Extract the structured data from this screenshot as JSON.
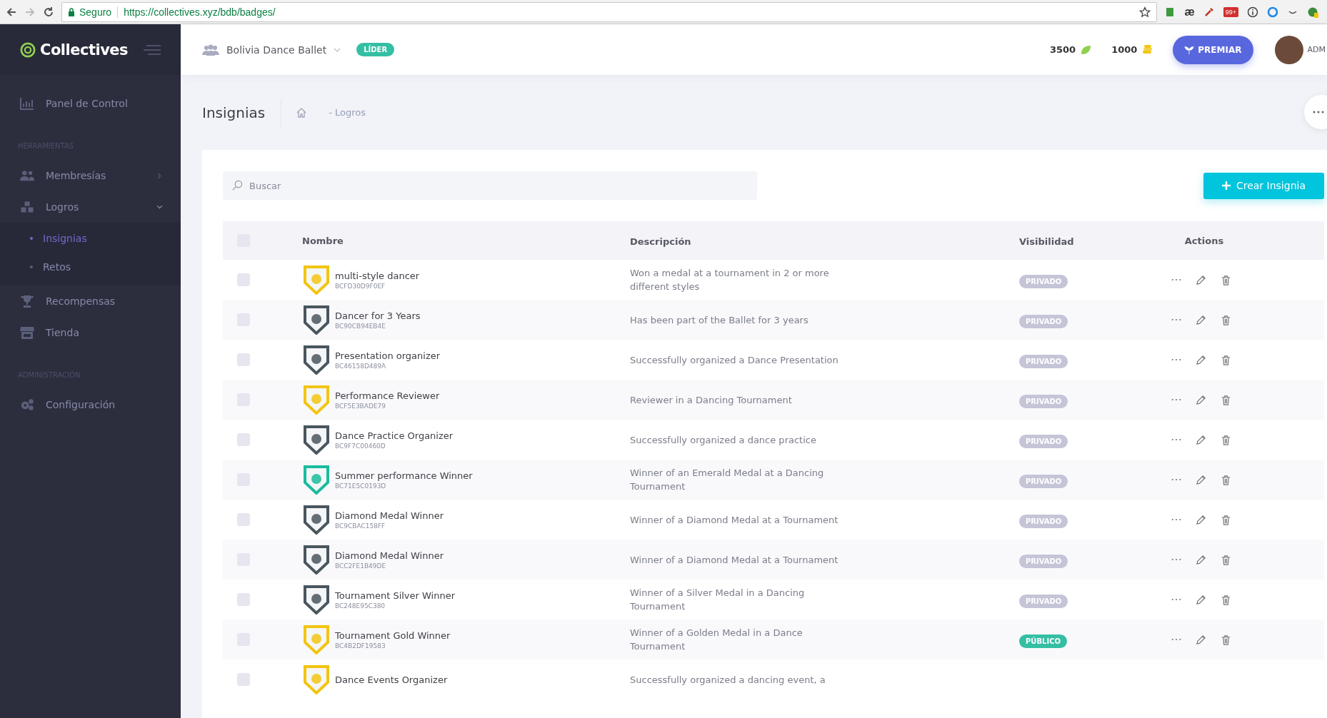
{
  "browser": {
    "secure_label": "Seguro",
    "url": "https://collectives.xyz/bdb/badges/",
    "extension_text": "æ",
    "extension_badge": "99+"
  },
  "sidebar": {
    "logo": "Collectives",
    "items": [
      {
        "kind": "chart",
        "label": "Panel de Control",
        "selected": false
      },
      {
        "kind": "heading",
        "label": "HERRAMIENTAS"
      },
      {
        "kind": "people",
        "label": "Membresías",
        "selected": false,
        "expanded": false
      },
      {
        "kind": "cubes",
        "label": "Logros",
        "selected": false,
        "expanded": true,
        "children": [
          {
            "label": "Insignias",
            "selected": true
          },
          {
            "label": "Retos",
            "selected": false
          }
        ]
      },
      {
        "kind": "trophy",
        "label": "Recompensas",
        "selected": false
      },
      {
        "kind": "store",
        "label": "Tienda",
        "selected": false
      },
      {
        "kind": "heading",
        "label": "ADMINISTRACIÓN"
      },
      {
        "kind": "gears",
        "label": "Configuración",
        "selected": false
      }
    ]
  },
  "header": {
    "group": "Bolivia Dance Ballet",
    "role": "LÍDER",
    "points": "3500",
    "coins": "1000",
    "award_button": "PREMIAR",
    "user": "ADM"
  },
  "page": {
    "title": "Insignias",
    "breadcrumb": "- Logros"
  },
  "search": {
    "placeholder": "Buscar"
  },
  "create_button": "Crear Insignia",
  "table": {
    "select_all_checked": false,
    "columns": [
      "Nombre",
      "Descripción",
      "Visibilidad",
      "Actions"
    ],
    "rows": [
      {
        "checked": false,
        "color": "#f2c511",
        "name": "multi-style dancer",
        "code": "BCFD30D9F0EF",
        "description": "Won a medal at a tournament in 2 or more different styles",
        "visibility": {
          "kind": "private",
          "label": "PRIVADO"
        }
      },
      {
        "checked": false,
        "color": "#4a565e",
        "name": "Dancer for 3 Years",
        "code": "BC90CB94EB4E",
        "description": "Has been part of the Ballet for 3 years",
        "visibility": {
          "kind": "private",
          "label": "PRIVADO"
        }
      },
      {
        "checked": false,
        "color": "#4a565e",
        "name": "Presentation organizer",
        "code": "BC46158D489A",
        "description": "Successfully organized a Dance Presentation",
        "visibility": {
          "kind": "private",
          "label": "PRIVADO"
        }
      },
      {
        "checked": false,
        "color": "#f2c511",
        "name": "Performance Reviewer",
        "code": "BCF5E3BADE79",
        "description": "Reviewer in a Dancing Tournament",
        "visibility": {
          "kind": "private",
          "label": "PRIVADO"
        }
      },
      {
        "checked": false,
        "color": "#4a565e",
        "name": "Dance Practice Organizer",
        "code": "BC9F7C00460D",
        "description": "Successfully organized a dance practice",
        "visibility": {
          "kind": "private",
          "label": "PRIVADO"
        }
      },
      {
        "checked": false,
        "color": "#1abc9c",
        "name": "Summer performance Winner",
        "code": "BC71E5C0193D",
        "description": "Winner of an Emerald Medal at a Dancing Tournament",
        "visibility": {
          "kind": "private",
          "label": "PRIVADO"
        }
      },
      {
        "checked": false,
        "color": "#4a565e",
        "name": "Diamond Medal Winner",
        "code": "BC9CBAC158FF",
        "description": "Winner of a Diamond Medal at a Tournament",
        "visibility": {
          "kind": "private",
          "label": "PRIVADO"
        }
      },
      {
        "checked": false,
        "color": "#4a565e",
        "name": "Diamond Medal Winner",
        "code": "BCC2FE1B49DE",
        "description": "Winner of a Diamond Medal at a Tournament",
        "visibility": {
          "kind": "private",
          "label": "PRIVADO"
        }
      },
      {
        "checked": false,
        "color": "#4a565e",
        "name": "Tournament Silver Winner",
        "code": "BC248E95C380",
        "description": "Winner of a Silver Medal in a Dancing Tournament",
        "visibility": {
          "kind": "private",
          "label": "PRIVADO"
        }
      },
      {
        "checked": false,
        "color": "#f2c511",
        "name": "Tournament Gold Winner",
        "code": "BC4B2DF19583",
        "description": "Winner of a Golden Medal in a Dance Tournament",
        "visibility": {
          "kind": "public",
          "label": "PÚBLICO"
        }
      },
      {
        "checked": false,
        "color": "#f2c511",
        "name": "Dance Events Organizer",
        "description": "Successfully organized a dancing event, a"
      }
    ]
  }
}
